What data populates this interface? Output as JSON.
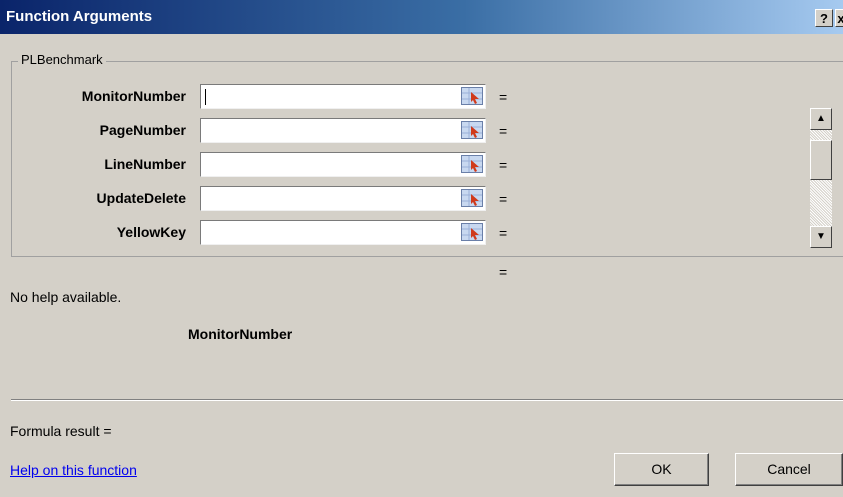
{
  "window": {
    "title": "Function Arguments",
    "help_glyph": "?",
    "close_glyph": "x"
  },
  "function_group": {
    "legend": "PLBenchmark",
    "arguments": [
      {
        "label": "MonitorNumber",
        "value": "",
        "result": "="
      },
      {
        "label": "PageNumber",
        "value": "",
        "result": "="
      },
      {
        "label": "LineNumber",
        "value": "",
        "result": "="
      },
      {
        "label": "UpdateDelete",
        "value": "",
        "result": "="
      },
      {
        "label": "YellowKey",
        "value": "",
        "result": "="
      }
    ],
    "scrollbar": {
      "up_glyph": "▲",
      "down_glyph": "▼"
    }
  },
  "result_equals": "=",
  "help_text": "No help available.",
  "selected_argument": "MonitorNumber",
  "formula_result": "Formula result =",
  "help_link": "Help on this function",
  "buttons": {
    "ok": "OK",
    "cancel": "Cancel"
  },
  "colors": {
    "titlebar_start": "#0a246a",
    "titlebar_end": "#a6caf0",
    "dialog_bg": "#d4d0c8",
    "link": "#0000ee"
  }
}
